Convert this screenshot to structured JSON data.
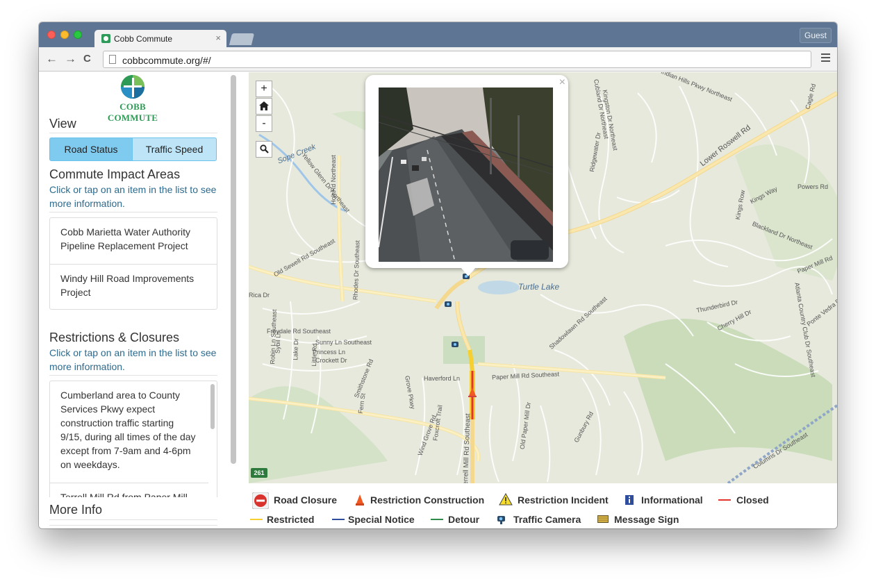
{
  "browser": {
    "tab_title": "Cobb Commute",
    "tab_close": "×",
    "guest_label": "Guest",
    "url": "cobbcommute.org/#/",
    "back": "←",
    "forward": "→",
    "reload": "C"
  },
  "sidebar": {
    "logo_text": "COBB COMMUTE",
    "view_heading": "View",
    "view_toggle": {
      "road_status": "Road Status",
      "traffic_speed": "Traffic Speed",
      "selected": "Road Status"
    },
    "impact_heading": "Commute Impact Areas",
    "impact_hint": "Click or tap on an item in the list to see more information.",
    "impact_items": [
      "Cobb Marietta Water Authority Pipeline Replacement Project",
      "Windy Hill Road Improvements Project"
    ],
    "restrictions_heading": "Restrictions & Closures",
    "restrictions_hint": "Click or tap on an item in the list to see more information.",
    "restrictions_items": [
      "Cumberland area to County Services Pkwy expect construction traffic starting 9/15, during all times of the day except from 7-9am and 4-6pm on weekdays.",
      "Terrell Mill Rd from Paper Mill"
    ],
    "more_info_heading": "More Info"
  },
  "map": {
    "zoom_in": "+",
    "zoom_out": "-",
    "home_icon": "home-icon",
    "search_icon": "search-icon",
    "popup_close": "×",
    "route_shield": "261",
    "labels": [
      "Lower Roswell Rd",
      "Turtle Lake",
      "Holt Rd Northeast",
      "Paper Mill Rd Southeast",
      "Terrell Mill Rd Southeast",
      "Thunderbird Dr",
      "Powers Rd",
      "Kings Way",
      "Kings Row",
      "Blackland Dr Northeast",
      "Paper Mill Rd",
      "Freydale Rd Southeast",
      "Sunny Ln Southeast",
      "Princess Ln",
      "Crockett Dr",
      "Haverford Ln",
      "Shadowlawn Rd Southeast",
      "Old Sewell Rd Southeast",
      "Rhodes Dr Southeast",
      "Sope Creek",
      "Yellow Glenn Dr Northeast",
      "Indian Hills Pkwy Northeast",
      "Cherry Hill Dr",
      "Columns Dr Southeast",
      "Ridgewater Dr",
      "Fern St",
      "Grove Pkwy",
      "Wind Grove Rd",
      "Foxcroft Trail",
      "Old Paper Mill Dr",
      "Gunbury Rd",
      "Atlanta Country Club Dr Southeast",
      "Ponte Vedra Dr",
      "Robin Ln Southeast",
      "Sybil Ln",
      "Lake Dr",
      "Little Rd",
      "Smithstone Rd",
      "Rica Dr",
      "Cagle Rd",
      "Cubland Dr Northeast",
      "Kingston Dr Northeast"
    ]
  },
  "legend": {
    "road_closure": "Road Closure",
    "restriction_construction": "Restriction Construction",
    "restriction_incident": "Restriction Incident",
    "informational": "Informational",
    "closed": "Closed",
    "restricted": "Restricted",
    "special_notice": "Special Notice",
    "detour": "Detour",
    "traffic_camera": "Traffic Camera",
    "message_sign": "Message Sign",
    "colors": {
      "closed": "#e3342f",
      "restricted": "#f5d030",
      "special_notice": "#2e4d9c",
      "detour": "#2e8b4a"
    }
  }
}
